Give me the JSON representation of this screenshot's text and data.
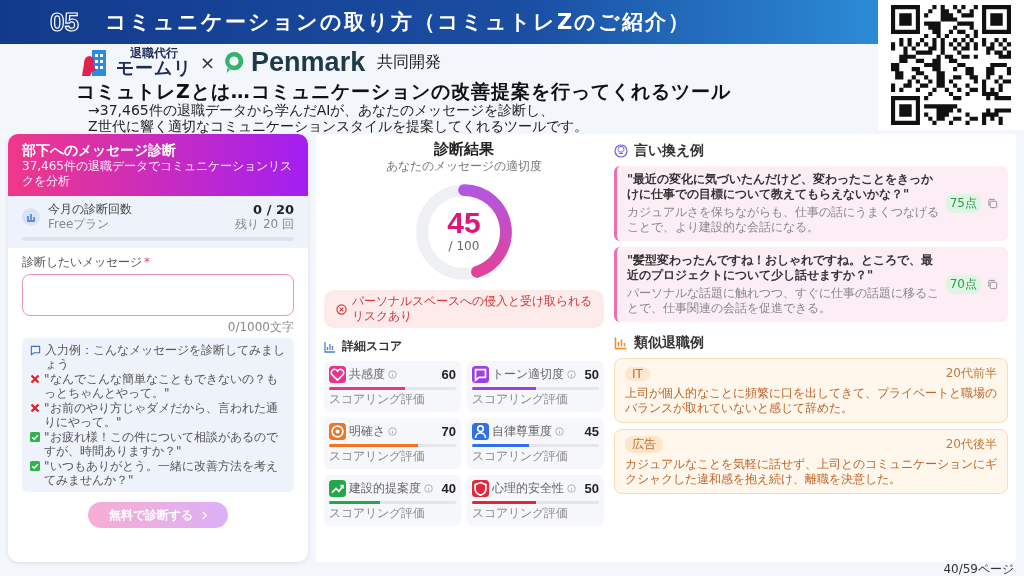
{
  "slide": {
    "number": "05",
    "title": "コミュニケーションの取り方（コミュトレZのご紹介）",
    "partners": {
      "brand_1_tagline": "退職代行",
      "brand_1_name": "モームリ",
      "separator": "×",
      "brand_2_name": "Penmark",
      "suffix": "共同開発"
    },
    "heading": "コミュトレZとは…コミュニケーションの改善提案を行ってくれるツール",
    "description": [
      "→37,465件の退職データから学んだAIが、あなたのメッセージを診断し、",
      "Z世代に響く適切なコミュニケーションスタイルを提案してくれるツールです。"
    ],
    "page": "40/59ページ"
  },
  "app": {
    "form": {
      "title": "部下へのメッセージ診断",
      "subtitle": "37,465件の退職データでコミュニケーションリスクを分析",
      "usage": {
        "label": "今月の診断回数",
        "plan": "Freeプラン",
        "count": "0 / 20",
        "remaining": "残り 20 回",
        "level": 0
      },
      "field_label": "診断したいメッセージ",
      "required_mark": "*",
      "char_count": "0/1000文字",
      "examples_title": "入力例：こんなメッセージを診断してみましょう",
      "examples": [
        {
          "kind": "bad",
          "text": "\"なんでこんな簡単なこともできないの？もっとちゃんとやって。\""
        },
        {
          "kind": "bad",
          "text": "\"お前のやり方じゃダメだから、言われた通りにやって。\""
        },
        {
          "kind": "good",
          "text": "\"お疲れ様！この件について相談があるのですが、時間ありますか？\""
        },
        {
          "kind": "good",
          "text": "\"いつもありがとう。一緒に改善方法を考えてみませんか？\""
        }
      ],
      "submit": {
        "label": "無料で診断する",
        "disabled": true
      }
    },
    "result": {
      "title": "診断結果",
      "subtitle": "あなたのメッセージの適切度",
      "score": "45",
      "max": "/ 100",
      "level": 0.45,
      "risk": "パーソナルスペースへの侵入と受け取られるリスクあり"
    },
    "scores": {
      "title": "詳細スコア",
      "items": [
        {
          "label": "共感度",
          "value": "60",
          "caption": "スコアリング評価",
          "level": 0.6,
          "color": "#e8348a"
        },
        {
          "label": "トーン適切度",
          "value": "50",
          "caption": "スコアリング評価",
          "level": 0.5,
          "color": "#9b3fe8"
        },
        {
          "label": "明確さ",
          "value": "70",
          "caption": "スコアリング評価",
          "level": 0.7,
          "color": "#f27321"
        },
        {
          "label": "自律尊重度",
          "value": "45",
          "caption": "スコアリング評価",
          "level": 0.45,
          "color": "#2f6fe8"
        },
        {
          "label": "建設的提案度",
          "value": "40",
          "caption": "スコアリング評価",
          "level": 0.4,
          "color": "#20a84a"
        },
        {
          "label": "心理的安全性",
          "value": "50",
          "caption": "スコアリング評価",
          "level": 0.5,
          "color": "#e0283a"
        }
      ]
    },
    "rephrase": {
      "title": "言い換え例",
      "items": [
        {
          "quote": "\"最近の変化に気づいたんだけど、変わったことをきっかけに仕事での目標について教えてもらえないかな？\"",
          "note": "カジュアルさを保ちながらも、仕事の話にうまくつなげることで、より建設的な会話になる。",
          "score": "75点"
        },
        {
          "quote": "\"髪型変わったんですね！おしゃれですね。ところで、最近のプロジェクトについて少し話せますか？\"",
          "note": "パーソナルな話題に触れつつ、すぐに仕事の話題に移ることで、仕事関連の会話を促進できる。",
          "score": "70点"
        }
      ]
    },
    "similar": {
      "title": "類似退職例",
      "items": [
        {
          "tag": "IT",
          "age": "20代前半",
          "text": "上司が個人的なことに頻繁に口を出してきて、プライベートと職場のバランスが取れていないと感じて辞めた。"
        },
        {
          "tag": "広告",
          "age": "20代後半",
          "text": "カジュアルなことを気軽に話せず、上司とのコミュニケーションにギクシャクした違和感を抱え続け、離職を決意した。"
        }
      ]
    }
  }
}
